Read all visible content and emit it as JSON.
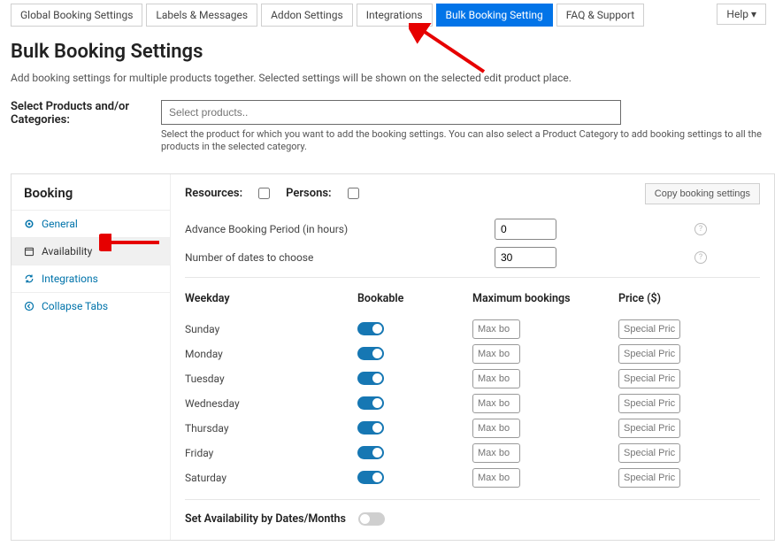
{
  "topTabs": [
    {
      "label": "Global Booking Settings",
      "active": false
    },
    {
      "label": "Labels & Messages",
      "active": false
    },
    {
      "label": "Addon Settings",
      "active": false
    },
    {
      "label": "Integrations",
      "active": false
    },
    {
      "label": "Bulk Booking Setting",
      "active": true
    },
    {
      "label": "FAQ & Support",
      "active": false
    }
  ],
  "helpLabel": "Help ▾",
  "pageTitle": "Bulk Booking Settings",
  "pageDesc": "Add booking settings for multiple products together. Selected settings will be shown on the selected edit product place.",
  "productSelector": {
    "label": "Select Products and/or Categories:",
    "placeholder": "Select products..",
    "help": "Select the product for which you want to add the booking settings. You can also select a Product Category to add booking settings to all the products in the selected category."
  },
  "sidebar": {
    "title": "Booking",
    "items": [
      {
        "key": "general",
        "label": "General",
        "icon": "gear"
      },
      {
        "key": "availability",
        "label": "Availability",
        "icon": "calendar",
        "active": true
      },
      {
        "key": "integrations",
        "label": "Integrations",
        "icon": "refresh"
      },
      {
        "key": "collapse",
        "label": "Collapse Tabs",
        "icon": "circle-left"
      }
    ]
  },
  "content": {
    "resourcesLabel": "Resources:",
    "personsLabel": "Persons:",
    "copyBtn": "Copy booking settings",
    "advanceLabel": "Advance Booking Period (in hours)",
    "advanceValue": "0",
    "numDatesLabel": "Number of dates to choose",
    "numDatesValue": "30",
    "columns": {
      "weekday": "Weekday",
      "bookable": "Bookable",
      "max": "Maximum bookings",
      "price": "Price ($)"
    },
    "maxPlaceholder": "Max bo",
    "pricePlaceholder": "Special Prici",
    "weekdays": [
      "Sunday",
      "Monday",
      "Tuesday",
      "Wednesday",
      "Thursday",
      "Friday",
      "Saturday"
    ],
    "datesToggleLabel": "Set Availability by Dates/Months"
  }
}
